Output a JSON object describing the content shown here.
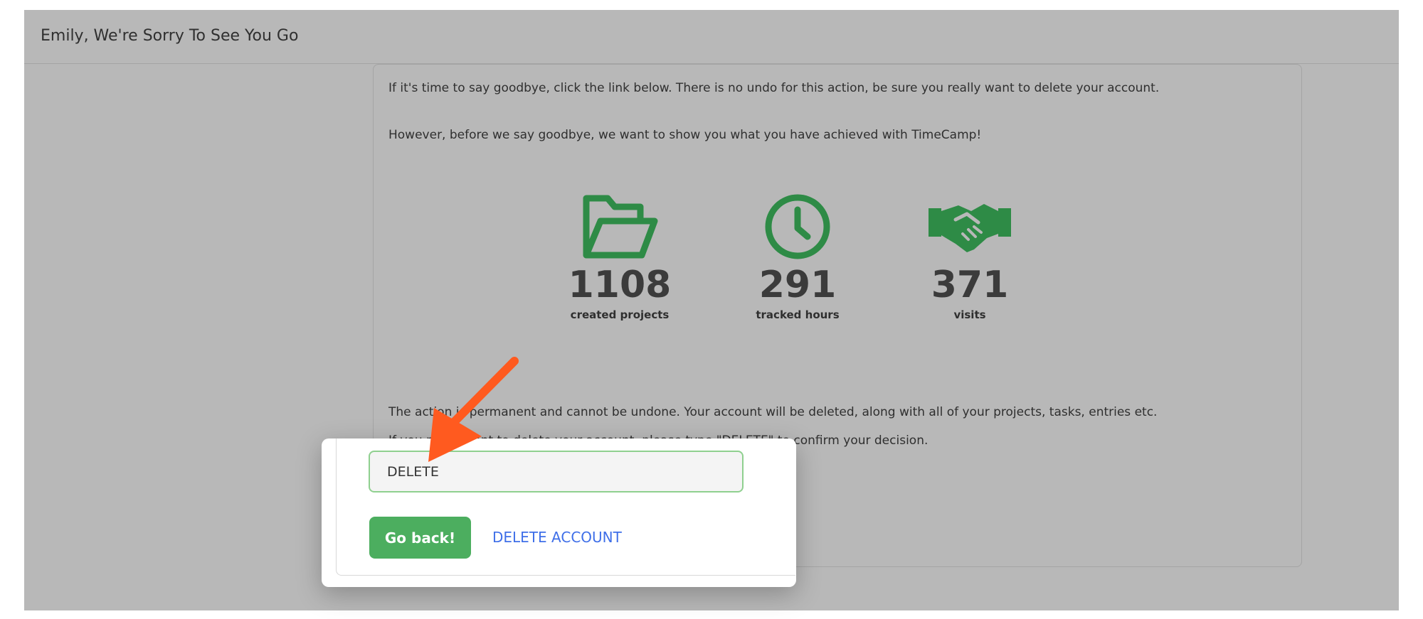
{
  "header": {
    "title": "Emily, We're Sorry To See You Go"
  },
  "content": {
    "intro": "If it's time to say goodbye, click the link below. There is no undo for this action, be sure you really want to delete your account.",
    "achievements_intro": "However, before we say goodbye, we want to show you what you have achieved with TimeCamp!",
    "warning": "The action is permanent and cannot be undone. Your account will be deleted, along with all of your projects, tasks, entries etc.",
    "confirm_instruction": "If you really want to delete your account, please type \"DELETE\" to confirm your decision."
  },
  "stats": [
    {
      "icon": "folder-open-icon",
      "value": "1108",
      "label": "created projects"
    },
    {
      "icon": "clock-icon",
      "value": "291",
      "label": "tracked hours"
    },
    {
      "icon": "handshake-icon",
      "value": "371",
      "label": "visits"
    }
  ],
  "confirm_dialog": {
    "input_value": "DELETE",
    "go_back_label": "Go back!",
    "delete_label": "DELETE ACCOUNT"
  },
  "colors": {
    "accent_green": "#2e8b46",
    "button_green": "#4cae5f",
    "link_blue": "#3f6fe8",
    "arrow_orange": "#ff5a1f"
  },
  "annotation": {
    "arrow_icon": "arrow-icon"
  }
}
